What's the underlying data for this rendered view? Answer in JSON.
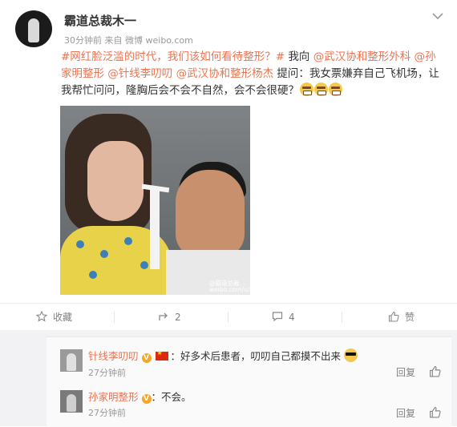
{
  "post": {
    "username": "霸道总裁木一",
    "time": "30分钟前",
    "source_prefix": "来自",
    "source": "微博 weibo.com",
    "content": {
      "hashtag": "#网红脸泛滥的时代，我们该如何看待整形？#",
      "text1": " 我向 ",
      "mention1": "@武汉协和整形外科",
      "mention2": "@孙家明整形",
      "mention3": "@针线李叨叨",
      "mention4": "@武汉协和整形杨杰",
      "text2": " 提问：我女票嫌弃自己飞机场，让我帮忙问问，隆胸后会不会不自然，会不会很硬？"
    },
    "image_watermark_line1": "@霸道总裁...",
    "image_watermark_line2": "weibo.com/u/547545..."
  },
  "actions": {
    "favorite_label": "收藏",
    "repost_count": "2",
    "comment_count": "4",
    "like_label": "赞"
  },
  "comments": [
    {
      "name": "针线李叨叨",
      "text": "：好多术后患者，叨叨自己都摸不出来",
      "time": "27分钟前",
      "reply_label": "回复"
    },
    {
      "name": "孙家明整形",
      "text": "：不会。",
      "time": "27分钟前",
      "reply_label": "回复"
    }
  ],
  "colors": {
    "link": "#eb7350",
    "meta_gray": "#999999",
    "comment_bg": "#fafafa"
  },
  "icons": [
    "chevron-down-icon",
    "star-icon",
    "repost-icon",
    "comment-icon",
    "thumbs-up-icon",
    "vip-badge-icon",
    "china-flag-icon",
    "cool-emoji-icon",
    "grimace-emoji-icon"
  ]
}
